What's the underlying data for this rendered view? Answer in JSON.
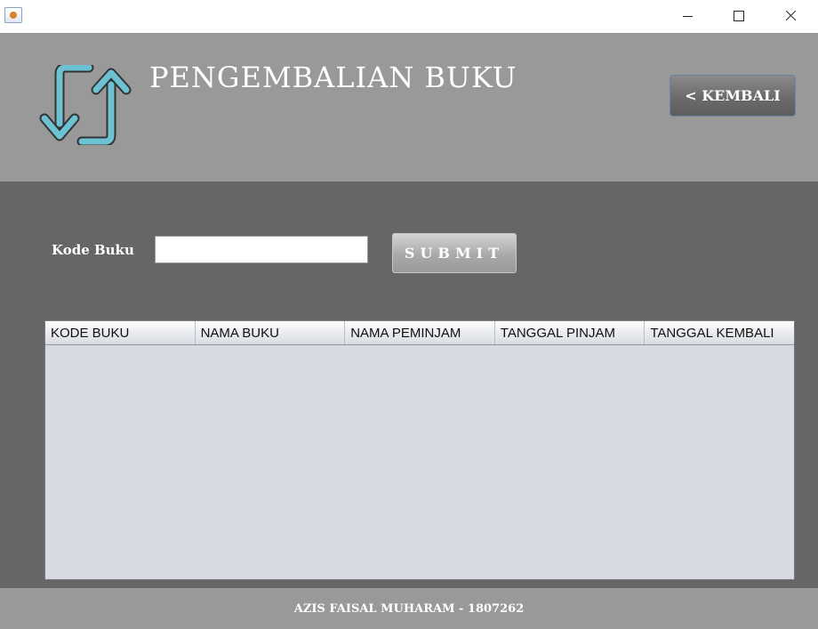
{
  "window": {
    "icon": "java-coffee-icon",
    "controls": [
      "minimize-icon",
      "maximize-icon",
      "close-icon"
    ]
  },
  "header": {
    "logo_icon": "return-arrows-icon",
    "title": "PENGEMBALIAN BUKU",
    "back_label": "< KEMBALI"
  },
  "form": {
    "kode_label": "Kode Buku",
    "kode_value": "",
    "submit_label": "SUBMIT"
  },
  "table": {
    "columns": [
      "KODE BUKU",
      "NAMA BUKU",
      "NAMA PEMINJAM",
      "TANGGAL PINJAM",
      "TANGGAL KEMBALI"
    ],
    "rows": []
  },
  "footer": {
    "text": "AZIS FAISAL MUHARAM - 1807262"
  },
  "colors": {
    "header_bg": "#999999",
    "main_bg": "#666666",
    "table_bg": "#d7dae1",
    "logo_arrow": "#6cc2d2"
  }
}
